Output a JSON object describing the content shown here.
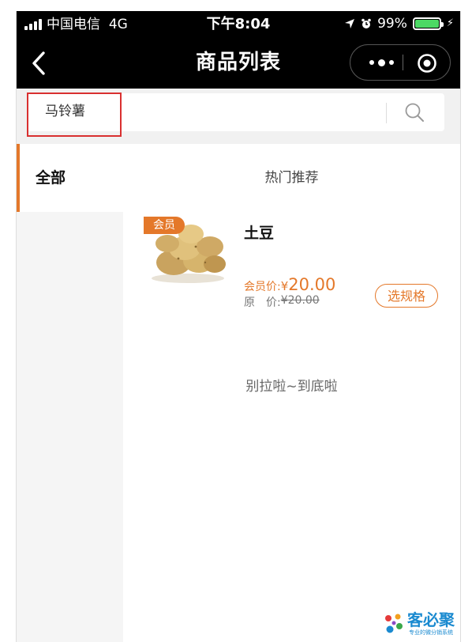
{
  "status_bar": {
    "carrier": "中国电信",
    "network": "4G",
    "time": "下午8:04",
    "battery": "99%"
  },
  "nav": {
    "title": "商品列表"
  },
  "search": {
    "value": "马铃薯"
  },
  "sidebar": {
    "categories": [
      {
        "label": "全部",
        "active": true
      }
    ]
  },
  "main": {
    "section_title": "热门推荐",
    "products": [
      {
        "badge": "会员",
        "name": "土豆",
        "member_price_label": "会员价:",
        "currency": "¥",
        "member_price": "20.00",
        "original_price_label": "原　价:",
        "original_price": "¥20.00",
        "spec_button": "选规格"
      }
    ],
    "end_tip": "别拉啦~到底啦"
  },
  "watermark": {
    "name": "客必聚",
    "slogan": "专业的微分销系统"
  },
  "colors": {
    "accent": "#e4782a",
    "highlight_border": "#d93030",
    "battery": "#4cd964"
  }
}
